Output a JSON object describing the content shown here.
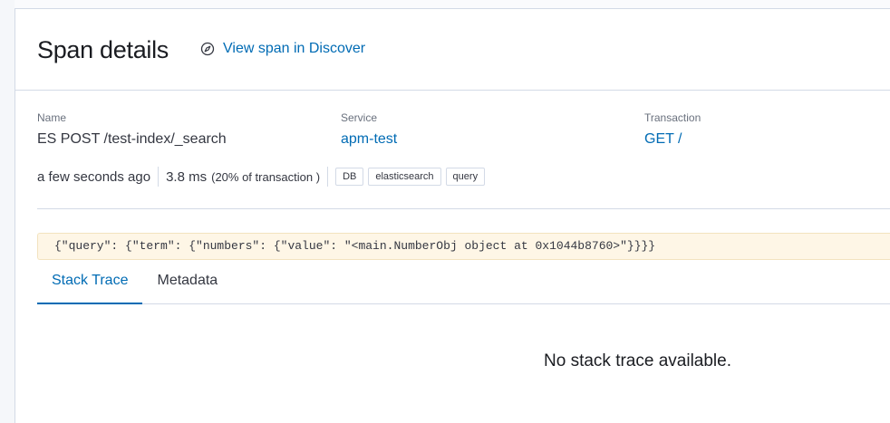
{
  "flyout": {
    "title": "Span details",
    "discover_link": "View span in Discover"
  },
  "meta": {
    "name_label": "Name",
    "name_value": "ES POST /test-index/_search",
    "service_label": "Service",
    "service_value": "apm-test",
    "transaction_label": "Transaction",
    "transaction_value": "GET /"
  },
  "summary": {
    "timestamp": "a few seconds ago",
    "duration": "3.8 ms",
    "percent": "(20% of transaction )",
    "badges": [
      "DB",
      "elasticsearch",
      "query"
    ]
  },
  "db_statement": "{\"query\": {\"term\": {\"numbers\": {\"value\": \"<main.NumberObj object at 0x1044b8760>\"}}}}",
  "tabs": [
    {
      "label": "Stack Trace",
      "active": true
    },
    {
      "label": "Metadata",
      "active": false
    }
  ],
  "empty_message": "No stack trace available.",
  "colors": {
    "link": "#006bb4",
    "text": "#343741",
    "code_bg": "#fef6e6"
  },
  "icons": {
    "discover": "compass-icon"
  }
}
